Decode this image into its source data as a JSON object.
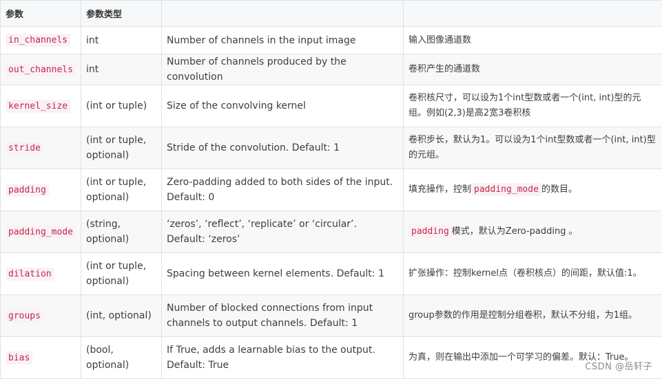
{
  "table": {
    "headers": [
      "参数",
      "参数类型",
      "",
      ""
    ],
    "rows": [
      {
        "param": "in_channels",
        "type": "int",
        "desc": "Number of channels in the input image",
        "cn": "输入图像通道数"
      },
      {
        "param": "out_channels",
        "type": "int",
        "desc": "Number of channels produced by the convolution",
        "cn": "卷积产生的通道数"
      },
      {
        "param": "kernel_size",
        "type": "(int or tuple)",
        "desc": "Size of the convolving kernel",
        "cn": "卷积核尺寸，可以设为1个int型数或者一个(int, int)型的元组。例如(2,3)是高2宽3卷积核"
      },
      {
        "param": "stride",
        "type": "(int or tuple, optional)",
        "desc": "Stride of the convolution. Default: 1",
        "cn": "卷积步长，默认为1。可以设为1个int型数或者一个(int, int)型的元组。"
      },
      {
        "param": "padding",
        "type": "(int or tuple, optional)",
        "desc": "Zero-padding added to both sides of the input. Default: 0",
        "cn_pre": "填充操作，控制",
        "cn_code": "padding_mode",
        "cn_post": "的数目。"
      },
      {
        "param": "padding_mode",
        "type": "(string, optional)",
        "desc": "‘zeros’, ‘reflect’, ‘replicate’ or ‘circular’. Default: ‘zeros’",
        "cn_pre": "",
        "cn_code": "padding",
        "cn_post": "模式，默认为Zero-padding 。"
      },
      {
        "param": "dilation",
        "type": "(int or tuple, optional)",
        "desc": "Spacing between kernel elements. Default: 1",
        "cn": "扩张操作：控制kernel点（卷积核点）的间距，默认值:1。"
      },
      {
        "param": "groups",
        "type": "(int, optional)",
        "desc": "Number of blocked connections from input channels to output channels. Default: 1",
        "cn": "group参数的作用是控制分组卷积，默认不分组，为1组。"
      },
      {
        "param": "bias",
        "type": "(bool, optional)",
        "desc": "If True, adds a learnable bias to the output. Default: True",
        "cn": "为真，则在输出中添加一个可学习的偏差。默认：True。"
      }
    ]
  },
  "watermark": "CSDN @岳轩子"
}
